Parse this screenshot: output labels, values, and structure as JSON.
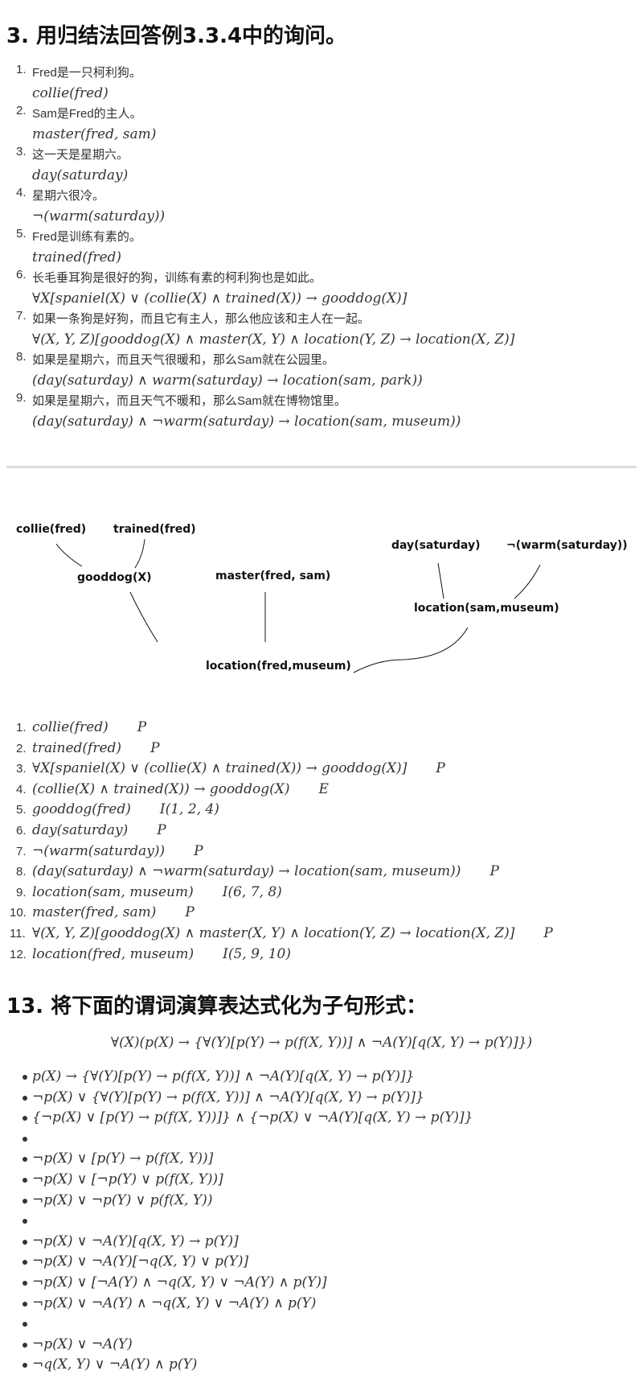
{
  "section3": {
    "heading": "3. 用归结法回答例3.3.4中的询问。",
    "items": [
      {
        "num": "1.",
        "text": "Fred是一只柯利狗。",
        "formula": "collie(fred)"
      },
      {
        "num": "2.",
        "text": "Sam是Fred的主人。",
        "formula": "master(fred, sam)"
      },
      {
        "num": "3.",
        "text": "这一天是星期六。",
        "formula": "day(saturday)"
      },
      {
        "num": "4.",
        "text": "星期六很冷。",
        "formula": "¬(warm(saturday))"
      },
      {
        "num": "5.",
        "text": "Fred是训练有素的。",
        "formula": "trained(fred)"
      },
      {
        "num": "6.",
        "text": "长毛垂耳狗是很好的狗，训练有素的柯利狗也是如此。",
        "formula": "∀X[spaniel(X) ∨ (collie(X) ∧ trained(X)) → gooddog(X)]"
      },
      {
        "num": "7.",
        "text": "如果一条狗是好狗，而且它有主人，那么他应该和主人在一起。",
        "formula": "∀(X, Y, Z)[gooddog(X) ∧ master(X, Y) ∧ location(Y, Z) → location(X, Z)]"
      },
      {
        "num": "8.",
        "text": "如果是星期六，而且天气很暖和，那么Sam就在公园里。",
        "formula": "(day(saturday) ∧ warm(saturday) → location(sam, park))"
      },
      {
        "num": "9.",
        "text": "如果是星期六，而且天气不暖和，那么Sam就在博物馆里。",
        "formula": "(day(saturday) ∧ ¬warm(saturday) → location(sam, museum))"
      }
    ]
  },
  "diagram": {
    "nodes": {
      "collie": "collie(fred)",
      "trained": "trained(fred)",
      "gooddog": "gooddog(X)",
      "master": "master(fred, sam)",
      "day": "day(saturday)",
      "notwarm": "¬(warm(saturday))",
      "location_sam": "location(sam,museum)",
      "location_fred": "location(fred,museum)"
    }
  },
  "proof": [
    {
      "num": "1.",
      "formula": "collie(fred)",
      "rule": "P"
    },
    {
      "num": "2.",
      "formula": "trained(fred)",
      "rule": "P"
    },
    {
      "num": "3.",
      "formula": "∀X[spaniel(X) ∨ (collie(X) ∧ trained(X)) → gooddog(X)]",
      "rule": "P"
    },
    {
      "num": "4.",
      "formula": "(collie(X) ∧ trained(X)) → gooddog(X)",
      "rule": "E"
    },
    {
      "num": "5.",
      "formula": "gooddog(fred)",
      "rule": "I(1, 2, 4)"
    },
    {
      "num": "6.",
      "formula": "day(saturday)",
      "rule": "P"
    },
    {
      "num": "7.",
      "formula": "¬(warm(saturday))",
      "rule": "P"
    },
    {
      "num": "8.",
      "formula": "(day(saturday) ∧ ¬warm(saturday) → location(sam, museum))",
      "rule": "P"
    },
    {
      "num": "9.",
      "formula": "location(sam, museum)",
      "rule": "I(6, 7, 8)"
    },
    {
      "num": "10.",
      "formula": "master(fred, sam)",
      "rule": "P"
    },
    {
      "num": "11.",
      "formula": "∀(X, Y, Z)[gooddog(X) ∧ master(X, Y) ∧ location(Y, Z) → location(X, Z)]",
      "rule": "P"
    },
    {
      "num": "12.",
      "formula": "location(fred, museum)",
      "rule": "I(5, 9, 10)"
    }
  ],
  "section13": {
    "heading": "13. 将下面的谓词演算表达式化为子句形式：",
    "main_formula": "∀(X)(p(X) → {∀(Y)[p(Y) → p(f(X, Y))] ∧ ¬A(Y)[q(X, Y) → p(Y)]})",
    "bullets": [
      "p(X) → {∀(Y)[p(Y) → p(f(X, Y))] ∧ ¬A(Y)[q(X, Y) → p(Y)]}",
      "¬p(X) ∨ {∀(Y)[p(Y) → p(f(X, Y))] ∧ ¬A(Y)[q(X, Y) → p(Y)]}",
      "{¬p(X) ∨ [p(Y) → p(f(X, Y))]} ∧ {¬p(X) ∨ ¬A(Y)[q(X, Y) → p(Y)]}",
      "",
      "¬p(X) ∨ [p(Y) → p(f(X, Y))]",
      "¬p(X) ∨ [¬p(Y) ∨ p(f(X, Y))]",
      "¬p(X) ∨ ¬p(Y) ∨ p(f(X, Y))",
      "",
      "¬p(X) ∨ ¬A(Y)[q(X, Y) → p(Y)]",
      "¬p(X) ∨ ¬A(Y)[¬q(X, Y) ∨ p(Y)]",
      "¬p(X) ∨ [¬A(Y) ∧ ¬q(X, Y) ∨ ¬A(Y) ∧ p(Y)]",
      "¬p(X) ∨ ¬A(Y) ∧ ¬q(X, Y) ∨ ¬A(Y) ∧ p(Y)",
      "",
      "¬p(X) ∨ ¬A(Y)",
      "¬q(X, Y) ∨ ¬A(Y) ∧ p(Y)"
    ]
  }
}
